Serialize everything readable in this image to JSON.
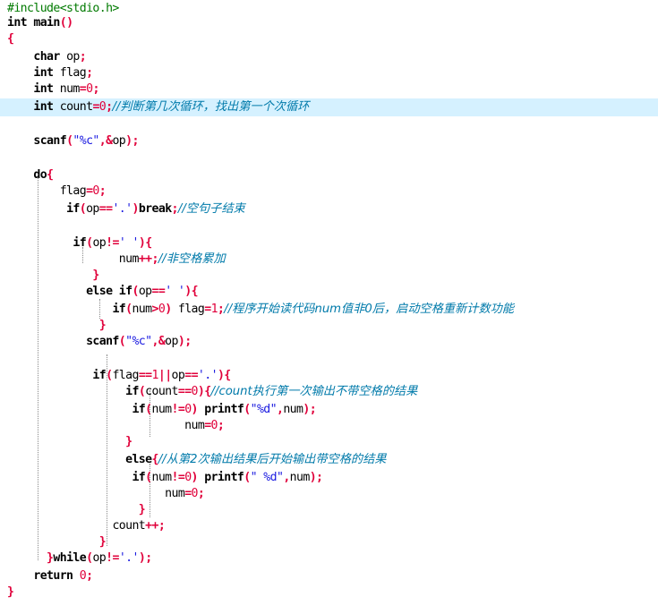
{
  "editor": {
    "lines": [
      "#include<stdio.h>",
      "int main()",
      "{",
      "    char op;",
      "    int flag;",
      "    int num=0;",
      "    int count=0;//判断第几次循环，找出第一个次循环",
      "",
      "    scanf(\"%c\",&op);",
      "",
      "    do{",
      "        flag=0;",
      "         if(op=='.')break;//空句子结束",
      "",
      "          if(op!=' '){",
      "                 num++;//非空格累加",
      "             }",
      "            else if(op==' '){",
      "                if(num>0) flag=1;//程序开始读代码num值非0后，启动空格重新计数功能",
      "              }",
      "            scanf(\"%c\",&op);",
      "",
      "             if(flag==1||op=='.'){",
      "                  if(count==0){//count执行第一次输出不带空格的结果",
      "                   if(num!=0) printf(\"%d\",num);",
      "                           num=0;",
      "                  }",
      "                  else{//从第2次输出结果后开始输出带空格的结果",
      "                   if(num!=0) printf(\" %d\",num);",
      "                        num=0;",
      "                    }",
      "                count++;",
      "              }",
      "      }while(op!='.');",
      "    return 0;",
      "}"
    ]
  }
}
